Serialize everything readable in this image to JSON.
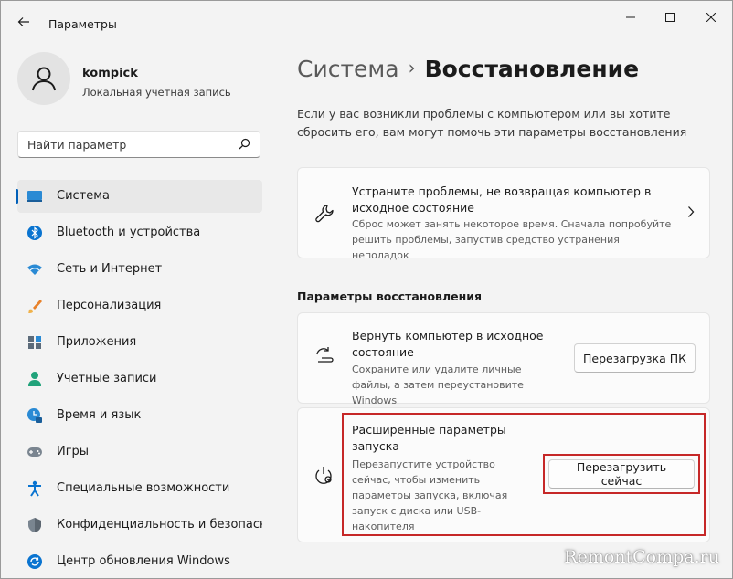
{
  "window": {
    "title": "Параметры"
  },
  "profile": {
    "name": "kompick",
    "account_type": "Локальная учетная запись"
  },
  "search": {
    "placeholder": "Найти параметр"
  },
  "nav": [
    {
      "label": "Система",
      "icon": "system-icon",
      "active": true
    },
    {
      "label": "Bluetooth и устройства",
      "icon": "bluetooth-icon"
    },
    {
      "label": "Сеть и Интернет",
      "icon": "wifi-icon"
    },
    {
      "label": "Персонализация",
      "icon": "brush-icon"
    },
    {
      "label": "Приложения",
      "icon": "apps-icon"
    },
    {
      "label": "Учетные записи",
      "icon": "accounts-icon"
    },
    {
      "label": "Время и язык",
      "icon": "time-language-icon"
    },
    {
      "label": "Игры",
      "icon": "gaming-icon"
    },
    {
      "label": "Специальные возможности",
      "icon": "accessibility-icon"
    },
    {
      "label": "Конфиденциальность и безопасность",
      "icon": "shield-icon"
    },
    {
      "label": "Центр обновления Windows",
      "icon": "windows-update-icon"
    }
  ],
  "breadcrumb": {
    "parent": "Система",
    "separator": "›",
    "current": "Восстановление"
  },
  "description": "Если у вас возникли проблемы с компьютером или вы хотите сбросить его, вам могут помочь эти параметры восстановления",
  "troubleshoot_card": {
    "title": "Устраните проблемы, не возвращая компьютер в исходное состояние",
    "description": "Сброс может занять некоторое время. Сначала попробуйте решить проблемы, запустив средство устранения неполадок"
  },
  "recovery_section": {
    "heading": "Параметры восстановления"
  },
  "reset_card": {
    "title": "Вернуть компьютер в исходное состояние",
    "description": "Сохраните или удалите личные файлы, а затем переустановите Windows",
    "button": "Перезагрузка ПК"
  },
  "advanced_card": {
    "title": "Расширенные параметры запуска",
    "description": "Перезапустите устройство сейчас, чтобы изменить параметры запуска, включая запуск с диска или USB-накопителя",
    "button": "Перезагрузить сейчас"
  },
  "watermark": "RemontCompa.ru",
  "colors": {
    "accent": "#005fb8",
    "highlight": "#c62828"
  }
}
